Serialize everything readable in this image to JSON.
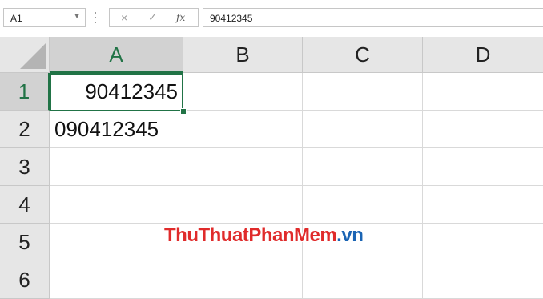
{
  "formula_bar": {
    "name_box": "A1",
    "cancel_icon": "×",
    "enter_icon": "✓",
    "fx_label": "fx",
    "formula_value": "90412345"
  },
  "columns": [
    "A",
    "B",
    "C",
    "D"
  ],
  "rows": [
    "1",
    "2",
    "3",
    "4",
    "5",
    "6"
  ],
  "cells": {
    "A1": "90412345",
    "A2": "090412345"
  },
  "active_cell": "A1",
  "watermark": {
    "part1": "ThuThuat",
    "part2": "PhanMem",
    "part3": ".vn"
  },
  "colors": {
    "accent": "#217346",
    "watermark_red": "#e02b2b",
    "watermark_blue": "#1a64b4"
  }
}
